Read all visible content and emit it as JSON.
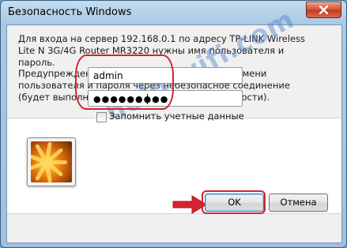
{
  "window": {
    "title": "Безопасность Windows",
    "close_symbol": "✕"
  },
  "message": {
    "line1": "Для входа на сервер 192.168.0.1 по адресу TP-LINK Wireless Lite N 3G/4G Router MR3220 нужны имя пользователя и пароль.",
    "line2": "Предупреждение: Сервер требует передачи имени пользователя и пароля через небезопасное соединение (будет выполнена обычная проверка подлинности)."
  },
  "credentials": {
    "username_value": "admin",
    "password_value": "●●●●●●●●●",
    "remember_label": "Запомнить учетные данные",
    "remember_checked": false
  },
  "buttons": {
    "ok_label": "OK",
    "cancel_label": "Отмена"
  },
  "watermark": "help-wifi.com",
  "colors": {
    "annotation_red": "#d42430",
    "titlebar": "#a8c8e4",
    "close_button": "#c23a1f"
  },
  "icons": {
    "close": "close-icon",
    "user_tile": "user-picture-flower",
    "arrow": "red-arrow-right-icon"
  }
}
